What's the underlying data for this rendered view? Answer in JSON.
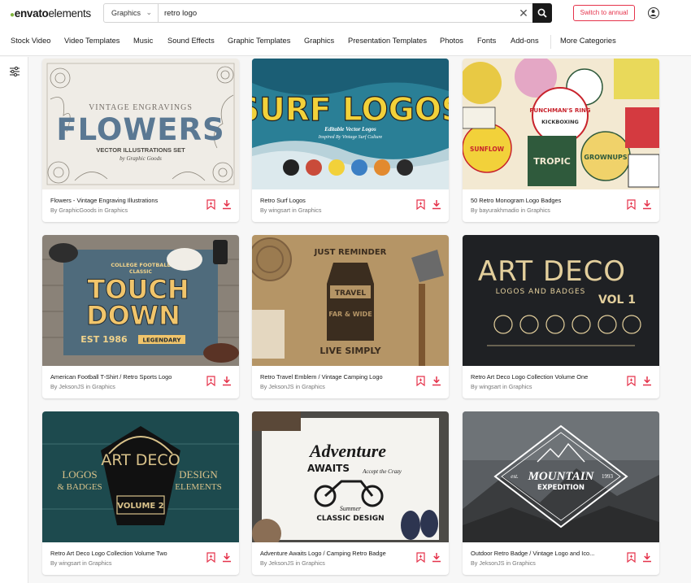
{
  "brand": {
    "logo_leaf": "●",
    "logo_word1": "envato",
    "logo_word2": "elements"
  },
  "search": {
    "category": "Graphics",
    "query": "retro logo",
    "clear_icon": "close-icon",
    "submit_icon": "search-icon"
  },
  "header": {
    "annual_button": "Switch to annual",
    "account_icon": "user-icon"
  },
  "nav": {
    "items": [
      "Stock Video",
      "Video Templates",
      "Music",
      "Sound Effects",
      "Graphic Templates",
      "Graphics",
      "Presentation Templates",
      "Photos",
      "Fonts",
      "Add-ons"
    ],
    "more": "More Categories"
  },
  "sidebar": {
    "filter_icon": "filter-sliders-icon"
  },
  "colors": {
    "accent": "#e5334b",
    "brand_green": "#82b540",
    "dark": "#191919"
  },
  "cards": [
    {
      "title": "Flowers - Vintage Engraving Illustrations",
      "author": "By GraphicGoods in Graphics",
      "art": {
        "l1": "VINTAGE ENGRAVINGS",
        "l2": "FLOWERS",
        "l3": "VECTOR ILLUSTRATIONS SET",
        "l4": "by Graphic Goods"
      }
    },
    {
      "title": "Retro Surf Logos",
      "author": "By wingsart in Graphics",
      "art": {
        "l1": "SURF LOGOS",
        "l2": "Editable Vector Logos",
        "l3": "Inspired By Vintage Surf Culture"
      }
    },
    {
      "title": "50 Retro Monogram Logo Badges",
      "author": "By bayurakhmadio in Graphics",
      "art": {
        "l1": "PUNCHMAN'S RING",
        "l2": "KICKBOXING",
        "l3": "TROPIC",
        "l4": "GROWNUPS",
        "l5": "SUNFLOW"
      }
    },
    {
      "title": "American Football T-Shirt / Retro Sports Logo",
      "author": "By JeksonJS in Graphics",
      "art": {
        "l1": "COLLEGE FOOTBALL",
        "l2": "CLASSIC",
        "l3": "TOUCH",
        "l4": "DOWN",
        "l5": "EST 1986",
        "l6": "LEGENDARY"
      }
    },
    {
      "title": "Retro Travel Emblem / Vintage Camping Logo",
      "author": "By JeksonJS in Graphics",
      "art": {
        "l1": "JUST REMINDER",
        "l2": "TRAVEL",
        "l3": "FAR & WIDE",
        "l4": "LIVE SIMPLY"
      }
    },
    {
      "title": "Retro Art Deco Logo Collection Volume One",
      "author": "By wingsart in Graphics",
      "art": {
        "l1": "ART DECO",
        "l2": "LOGOS AND BADGES",
        "l3": "VOL 1"
      }
    },
    {
      "title": "Retro Art Deco Logo Collection Volume Two",
      "author": "By wingsart in Graphics",
      "art": {
        "l1": "ART DECO",
        "l2": "LOGOS",
        "l3": "& BADGES",
        "l4": "DESIGN",
        "l5": "ELEMENTS",
        "l6": "VOLUME 2"
      }
    },
    {
      "title": "Adventure Awaits Logo / Camping Retro Badge",
      "author": "By JeksonJS in Graphics",
      "art": {
        "l1": "Adventure",
        "l2": "AWAITS",
        "l3": "Accept the Crazy",
        "l4": "Summer",
        "l5": "CLASSIC DESIGN"
      }
    },
    {
      "title": "Outdoor Retro Badge / Vintage Logo and Ico...",
      "author": "By JeksonJS in Graphics",
      "art": {
        "l1": "MOUNTAIN",
        "l2": "EXPEDITION",
        "l3": "est.",
        "l4": "1993"
      }
    }
  ]
}
